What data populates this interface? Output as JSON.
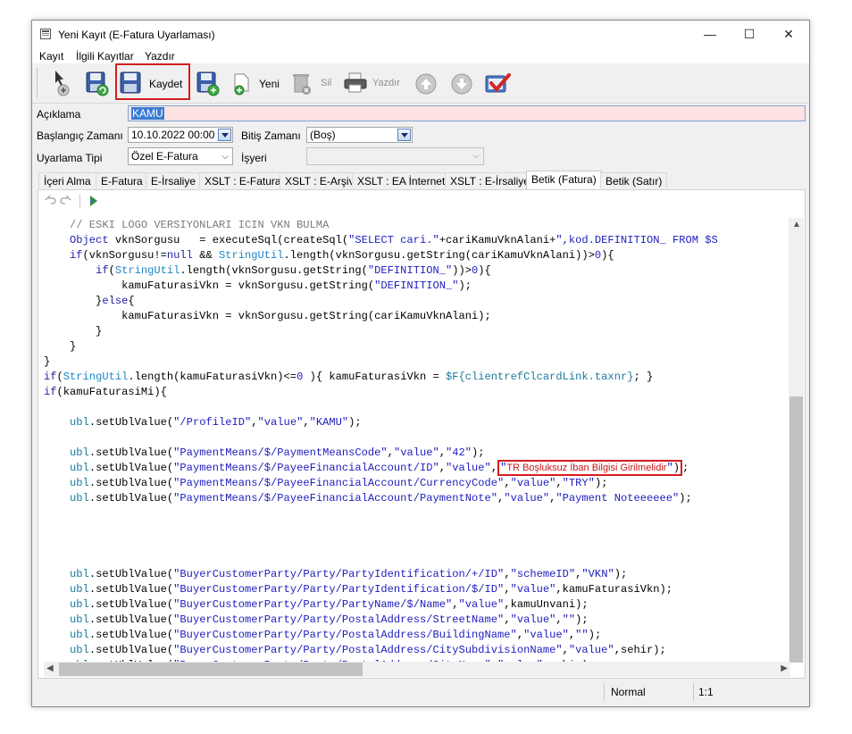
{
  "window": {
    "title": "Yeni Kayıt (E-Fatura Uyarlaması)",
    "minimize": "—",
    "maximize": "☐",
    "close": "✕"
  },
  "menu": [
    "Kayıt",
    "İlgili Kayıtlar",
    "Yazdır"
  ],
  "toolbar": {
    "save_label": "Kaydet",
    "new_label": "Yeni",
    "delete_label": "Sil",
    "print_label": "Yazdır"
  },
  "form": {
    "aciklama_label": "Açıklama",
    "aciklama_value": "KAMU",
    "baslangic_label": "Başlangıç Zamanı",
    "baslangic_value": "10.10.2022 00:00",
    "bitis_label": "Bitiş Zamanı",
    "bitis_value": "(Boş)",
    "uyarlama_label": "Uyarlama Tipi",
    "uyarlama_value": "Özel E-Fatura",
    "isyeri_label": "İşyeri",
    "isyeri_value": ""
  },
  "tabs": [
    "İçeri Alma",
    "E-Fatura",
    "E-İrsaliye",
    "XSLT : E-Fatura",
    "XSLT : E-Arşiv",
    "XSLT : EA İnternet",
    "XSLT : E-İrsaliye",
    "Betik (Fatura)",
    "Betik (Satır)"
  ],
  "active_tab": "Betik (Fatura)",
  "code": {
    "highlight_text": "TR Boşluksuz İban Bilgisi Girilmelidir"
  },
  "status": {
    "mode": "Normal",
    "position": "1:1"
  },
  "colors": {
    "highlight_border": "#d41d1d",
    "aciklama_bg": "#fde3e3",
    "selection": "#3a7bd5"
  }
}
